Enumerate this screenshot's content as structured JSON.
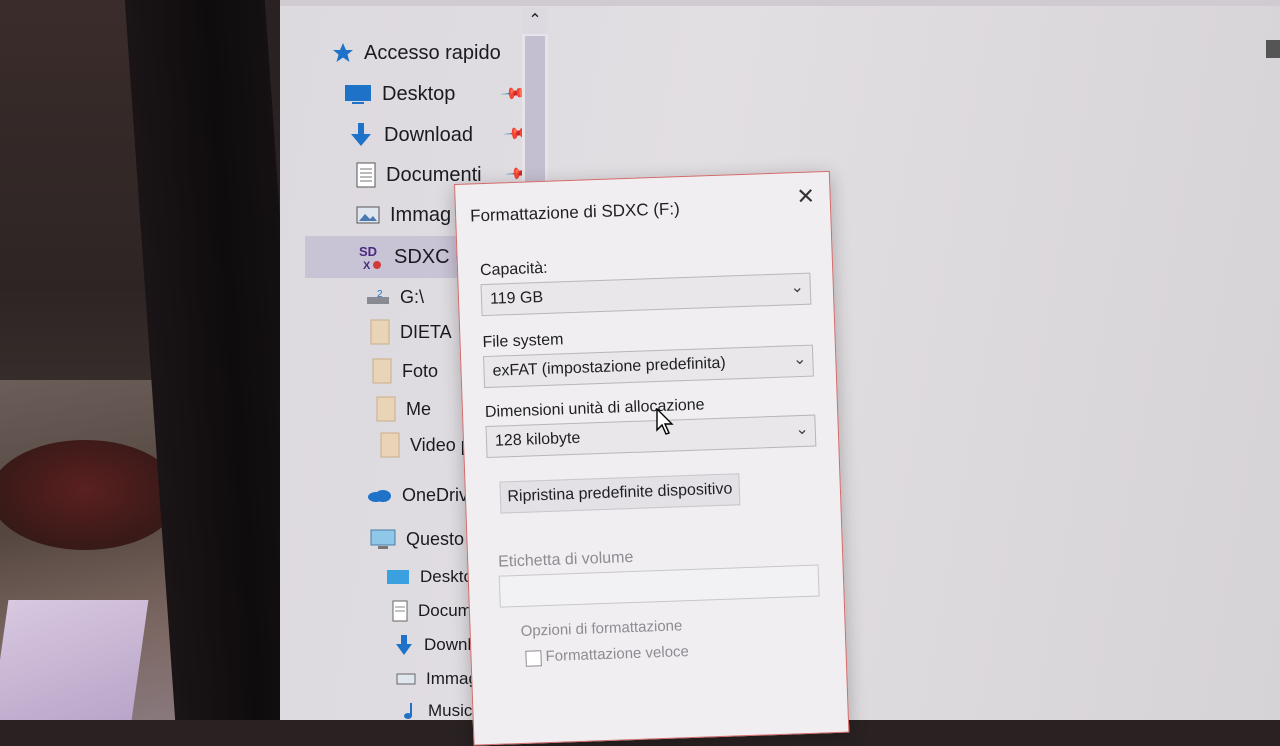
{
  "nav": {
    "quick_access": "Accesso rapido",
    "items": [
      {
        "label": "Desktop",
        "icon": "desktop-icon",
        "pinned": true
      },
      {
        "label": "Download",
        "icon": "download-icon",
        "pinned": true
      },
      {
        "label": "Documenti",
        "icon": "documents-icon",
        "pinned": true
      },
      {
        "label": "Immag",
        "icon": "pictures-icon",
        "pinned": false
      },
      {
        "label": "SDXC (",
        "icon": "sd-card-icon",
        "selected": true
      },
      {
        "label": "G:\\",
        "icon": "drive-icon"
      },
      {
        "label": "DIETA",
        "icon": "folder-icon"
      },
      {
        "label": "Foto",
        "icon": "folder-icon"
      },
      {
        "label": "Me",
        "icon": "folder-icon"
      },
      {
        "label": "Video p",
        "icon": "folder-icon"
      },
      {
        "label": "OneDriv",
        "icon": "onedrive-icon"
      },
      {
        "label": "Questo P",
        "icon": "this-pc-icon"
      },
      {
        "label": "Deskto",
        "icon": "desktop-icon"
      },
      {
        "label": "Docum",
        "icon": "documents-icon"
      },
      {
        "label": "Downlo",
        "icon": "download-icon"
      },
      {
        "label": "Immag",
        "icon": "pictures-icon"
      },
      {
        "label": "Musica",
        "icon": "music-icon"
      }
    ]
  },
  "dialog": {
    "title": "Formattazione di SDXC (F:)",
    "capacity_label": "Capacità:",
    "capacity_value": "119 GB",
    "filesystem_label": "File system",
    "filesystem_value": "exFAT (impostazione predefinita)",
    "allocation_label": "Dimensioni unità di allocazione",
    "allocation_value": "128 kilobyte",
    "restore_button": "Ripristina predefinite dispositivo",
    "volume_label": "Etichetta di volume",
    "volume_value": "",
    "options_label": "Opzioni di formattazione",
    "quick_format_label": "Formattazione veloce",
    "quick_format_checked": false
  },
  "colors": {
    "selection": "#c9c3d6",
    "dialog_border": "#d46a6a",
    "accent_blue": "#1e73c8"
  }
}
